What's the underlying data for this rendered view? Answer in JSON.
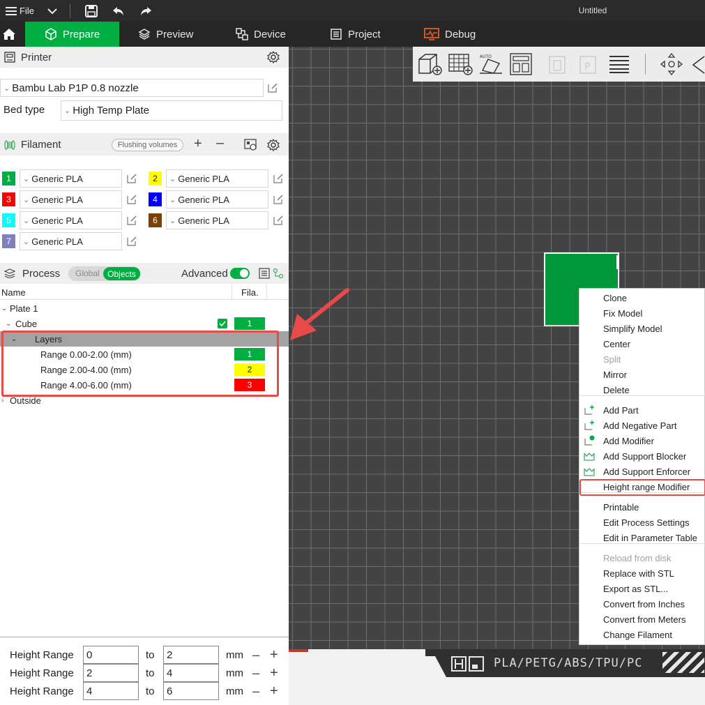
{
  "titlebar": {
    "file_label": "File",
    "title": "Untitled"
  },
  "tabs": [
    {
      "label": "Prepare"
    },
    {
      "label": "Preview"
    },
    {
      "label": "Device"
    },
    {
      "label": "Project"
    },
    {
      "label": "Debug"
    }
  ],
  "printer": {
    "header": "Printer",
    "model": "Bambu Lab P1P 0.8 nozzle",
    "bed_type_label": "Bed type",
    "bed_type_value": "High Temp Plate"
  },
  "filament": {
    "header": "Filament",
    "flushing_label": "Flushing volumes",
    "items": [
      {
        "num": "1",
        "name": "Generic PLA",
        "color": "#00ae42",
        "text": "#fff"
      },
      {
        "num": "2",
        "name": "Generic PLA",
        "color": "#ffff00",
        "text": "#222"
      },
      {
        "num": "3",
        "name": "Generic PLA",
        "color": "#ff0000",
        "text": "#fff"
      },
      {
        "num": "4",
        "name": "Generic PLA",
        "color": "#0000ff",
        "text": "#fff"
      },
      {
        "num": "5",
        "name": "Generic PLA",
        "color": "#00ffff",
        "text": "#fff"
      },
      {
        "num": "6",
        "name": "Generic PLA",
        "color": "#7b3f00",
        "text": "#fff"
      },
      {
        "num": "7",
        "name": "Generic PLA",
        "color": "#8080c0",
        "text": "#fff"
      }
    ]
  },
  "process": {
    "header": "Process",
    "global_label": "Global",
    "objects_label": "Objects",
    "advanced_label": "Advanced"
  },
  "objects": {
    "col_name": "Name",
    "col_fila": "Fila.",
    "plate": "Plate 1",
    "cube": "Cube",
    "cube_fila": "1",
    "layers": "Layers",
    "ranges": [
      {
        "label": "Range 0.00-2.00 (mm)",
        "fila": "1",
        "color": "#00ae42",
        "text": "#fff"
      },
      {
        "label": "Range 2.00-4.00 (mm)",
        "fila": "2",
        "color": "#ffff00",
        "text": "#222"
      },
      {
        "label": "Range 4.00-6.00 (mm)",
        "fila": "3",
        "color": "#ff0000",
        "text": "#fff"
      }
    ],
    "outside": "Outside"
  },
  "height_ranges": {
    "label": "Height Range",
    "to": "to",
    "unit": "mm",
    "rows": [
      {
        "from": "0",
        "to": "2"
      },
      {
        "from": "2",
        "to": "4"
      },
      {
        "from": "4",
        "to": "6"
      }
    ]
  },
  "context_menu": {
    "items": [
      "Clone",
      "Fix Model",
      "Simplify Model",
      "Center",
      "Split",
      "Mirror",
      "Delete",
      "Add Part",
      "Add Negative Part",
      "Add Modifier",
      "Add Support Blocker",
      "Add Support Enforcer",
      "Height range Modifier",
      "Printable",
      "Edit Process Settings",
      "Edit in Parameter Table",
      "Reload from disk",
      "Replace with STL",
      "Export as STL...",
      "Convert from Inches",
      "Convert from Meters",
      "Change Filament"
    ]
  },
  "bottom_strip": {
    "materials": "PLA/PETG/ABS/TPU/PC"
  },
  "colors": {
    "accent": "#00ae42",
    "highlight": "#e84a4a"
  }
}
